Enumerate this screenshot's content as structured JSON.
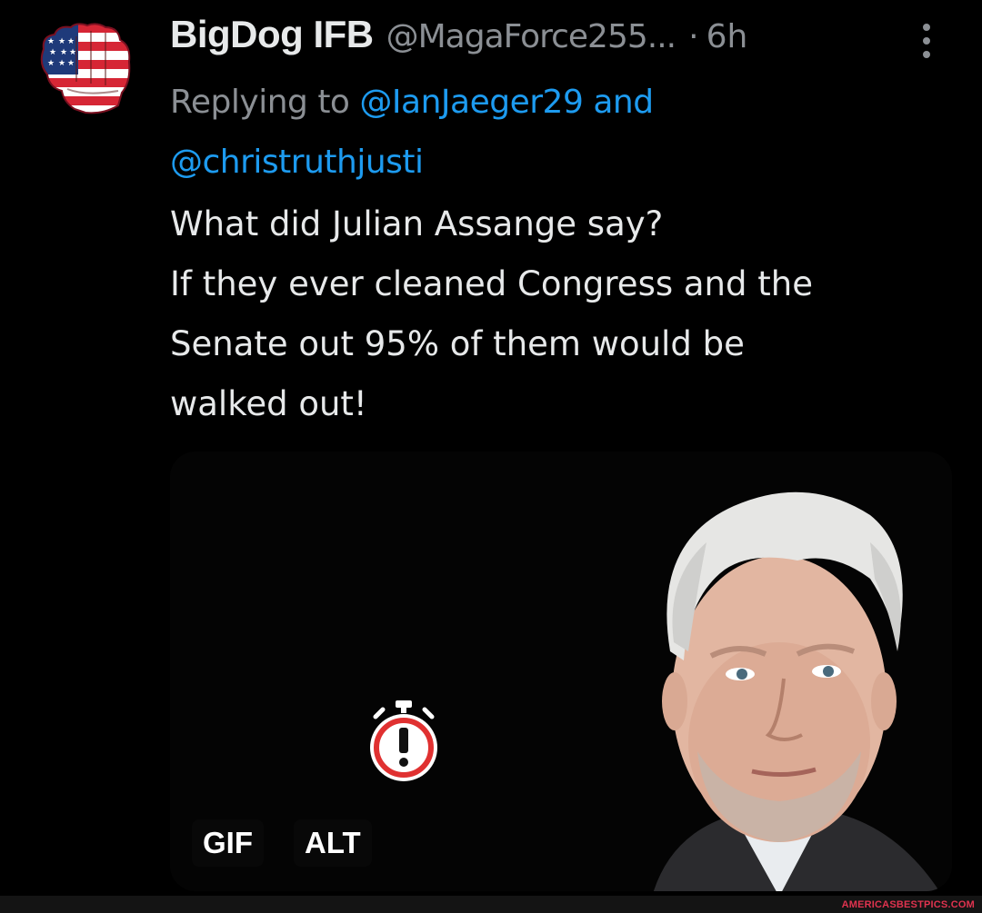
{
  "tweet": {
    "author": {
      "display_name": "BigDog IFB",
      "handle": "@MagaForce255...",
      "avatar_icon": "flag-fist-icon"
    },
    "separator": "·",
    "time": "6h",
    "more_icon": "more-vertical-icon",
    "reply": {
      "prefix": "Replying to",
      "mention_1": "@IanJaeger29",
      "conjunction": "and",
      "mention_2": "@christruthjusti"
    },
    "text_lines": [
      "What did Julian Assange say?",
      "If they ever cleaned Congress and the",
      "Senate out 95% of them would be",
      "walked out!"
    ],
    "media": {
      "warning_icon": "alarm-clock-warning-icon",
      "gif_badge": "GIF",
      "alt_badge": "ALT"
    }
  },
  "watermark": "AMERICASBESTPICS.COM",
  "colors": {
    "background": "#000000",
    "text_primary": "#e7e9ea",
    "text_secondary": "#8b8f94",
    "link": "#1d9bf0",
    "watermark": "#e0334f"
  }
}
